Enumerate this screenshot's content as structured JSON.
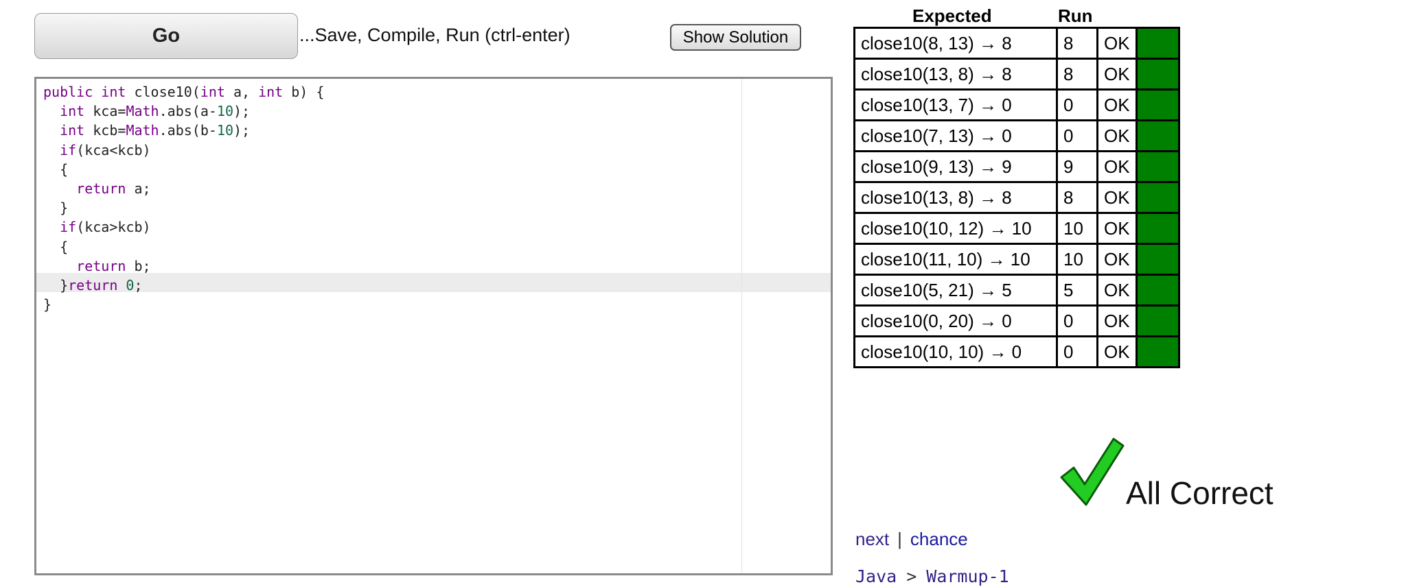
{
  "toolbar": {
    "go_label": "Go",
    "go_hint": "...Save, Compile, Run (ctrl-enter)",
    "show_solution_label": "Show Solution"
  },
  "results": {
    "header_expected": "Expected",
    "header_run": "Run",
    "rows": [
      {
        "expected": "close10(8, 13) → 8",
        "run": "8",
        "status": "OK"
      },
      {
        "expected": "close10(13, 8) → 8",
        "run": "8",
        "status": "OK"
      },
      {
        "expected": "close10(13, 7) → 0",
        "run": "0",
        "status": "OK"
      },
      {
        "expected": "close10(7, 13) → 0",
        "run": "0",
        "status": "OK"
      },
      {
        "expected": "close10(9, 13) → 9",
        "run": "9",
        "status": "OK"
      },
      {
        "expected": "close10(13, 8) → 8",
        "run": "8",
        "status": "OK"
      },
      {
        "expected": "close10(10, 12) → 10",
        "run": "10",
        "status": "OK"
      },
      {
        "expected": "close10(11, 10) → 10",
        "run": "10",
        "status": "OK"
      },
      {
        "expected": "close10(5, 21) → 5",
        "run": "5",
        "status": "OK"
      },
      {
        "expected": "close10(0, 20) → 0",
        "run": "0",
        "status": "OK"
      },
      {
        "expected": "close10(10, 10) → 0",
        "run": "0",
        "status": "OK"
      }
    ],
    "pass_color": "#008000"
  },
  "status": {
    "all_correct": "All Correct",
    "check_icon": "check-mark-icon",
    "check_color": "#22cc22"
  },
  "nav": {
    "next": "next",
    "separator": "|",
    "chance": "chance",
    "crumb_language": "Java",
    "crumb_sep": ">",
    "crumb_section": "Warmup-1"
  }
}
